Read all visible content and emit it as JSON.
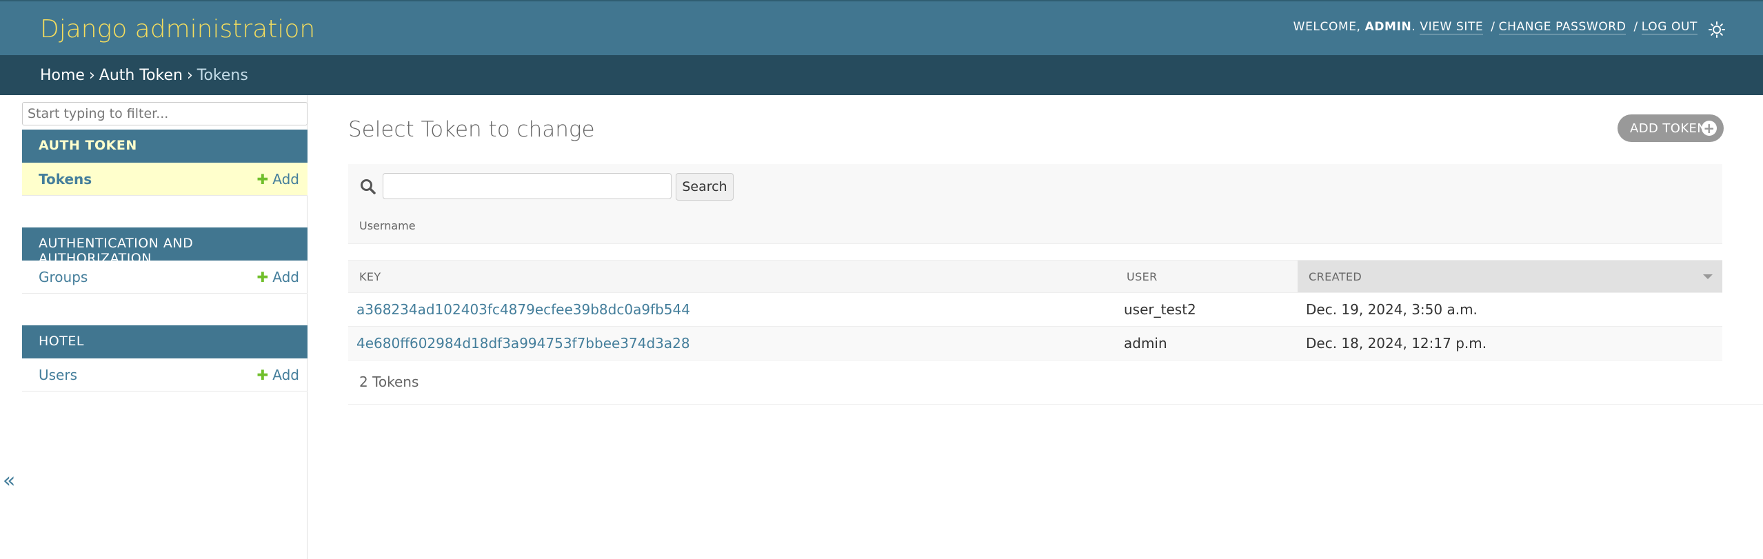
{
  "header": {
    "branding": "Django administration",
    "welcome": "WELCOME,",
    "username": "ADMIN",
    "view_site": "VIEW SITE",
    "change_password": "CHANGE PASSWORD",
    "log_out": "LOG OUT",
    "separator": "/",
    "theme_icon": "sun-icon"
  },
  "breadcrumbs": {
    "home": "Home",
    "app": "Auth Token",
    "current": "Tokens",
    "separator": "›"
  },
  "sidebar": {
    "filter_placeholder": "Start typing to filter...",
    "collapse_glyph": "«",
    "apps": [
      {
        "caption": "AUTH TOKEN",
        "models": [
          {
            "label": "Tokens",
            "add": "Add"
          }
        ]
      },
      {
        "caption": "AUTHENTICATION AND AUTHORIZATION",
        "models": [
          {
            "label": "Groups",
            "add": "Add"
          }
        ]
      },
      {
        "caption": "HOTEL",
        "models": [
          {
            "label": "Users",
            "add": "Add"
          }
        ]
      }
    ]
  },
  "main": {
    "title": "Select Token to change",
    "add_button": "ADD TOKEN",
    "search": {
      "value": "",
      "button": "Search",
      "help": "Username"
    },
    "table": {
      "columns": [
        "KEY",
        "USER",
        "CREATED"
      ],
      "rows": [
        {
          "key": "a368234ad102403fc4879ecfee39b8dc0a9fb544",
          "user": "user_test2",
          "created": "Dec. 19, 2024, 3:50 a.m."
        },
        {
          "key": "4e680ff602984d18df3a994753f7bbee374d3a28",
          "user": "admin",
          "created": "Dec. 18, 2024, 12:17 p.m."
        }
      ]
    },
    "paginator": "2 Tokens"
  },
  "colors": {
    "header_bg": "#417690",
    "breadcrumbs_bg": "#264b5d",
    "branding": "#f5dd5d",
    "link": "#447e9b",
    "add_plus": "#70bf2b",
    "current_model_bg": "#ffffcc"
  }
}
